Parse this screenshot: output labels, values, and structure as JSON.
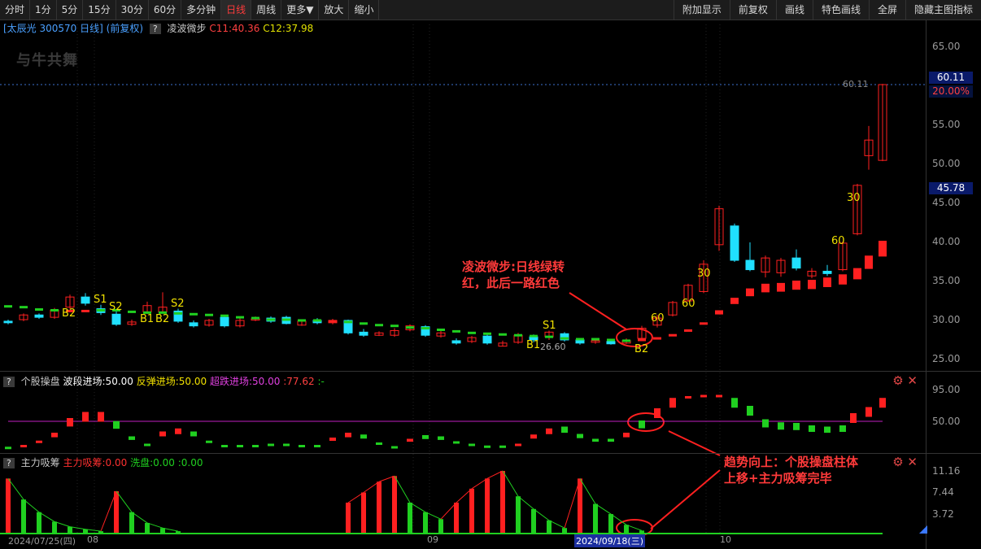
{
  "toolbar": {
    "left": [
      "分时",
      "1分",
      "5分",
      "15分",
      "30分",
      "60分",
      "多分钟",
      "日线",
      "周线",
      "更多▼",
      "放大",
      "缩小"
    ],
    "active": "日线",
    "right": [
      "附加显示",
      "前复权",
      "画线",
      "特色画线",
      "全屏",
      "隐藏主图指标"
    ]
  },
  "info": {
    "stock": "[太辰光 300570 日线]",
    "adj": "(前复权)",
    "q": "?",
    "indicator": "凌波微步",
    "c1": "C11:40.36",
    "c2": "C12:37.98"
  },
  "logo": "与牛共舞",
  "price_axis": [
    "65.00",
    "55.00",
    "50.00",
    "45.00",
    "40.00",
    "35.00",
    "30.00",
    "25.00"
  ],
  "price_tags": {
    "top": "60.11",
    "pct": "20.00%",
    "mid": "45.78",
    "line_label": "60.11"
  },
  "panel2": {
    "q": "?",
    "name": "个股操盘",
    "l1": "波段进场:50.00",
    "l2": "反弹进场:50.00",
    "l3": "超跌进场:50.00",
    "l4": ":77.62",
    "l5": ":-",
    "axis": [
      "95.00",
      "50.00"
    ]
  },
  "panel3": {
    "q": "?",
    "name": "主力吸筹",
    "l1": "主力吸筹:0.00",
    "l2": "洗盘:0.00",
    "l3": ":0.00",
    "axis": [
      "11.16",
      "7.44",
      "3.72"
    ]
  },
  "x_axis": {
    "d1": "2024/07/25(四)",
    "m8": "08",
    "m9": "09",
    "d2": "2024/09/18(三)",
    "m10": "10"
  },
  "labels": {
    "b2a": "B2",
    "s1a": "S1",
    "s2a": "S2",
    "b1a": "B1",
    "b2b": "B2",
    "s2b": "S2",
    "s1b": "S1",
    "b1b": "B1",
    "p2660": "26.60",
    "b2c": "B2",
    "n60a": "60",
    "n60b": "60",
    "n30a": "30",
    "n60c": "60",
    "n30b": "30"
  },
  "annotations": {
    "a1": "凌波微步:日线绿转红，此后一路红色",
    "a2": "趋势向上：个股操盘柱体上移+主力吸筹完毕"
  },
  "icons": [
    "gear-icon",
    "close-icon"
  ],
  "colors": {
    "up": "#ff2020",
    "down": "#20e0ff",
    "green": "#20d020",
    "purple": "#c020c0"
  }
}
